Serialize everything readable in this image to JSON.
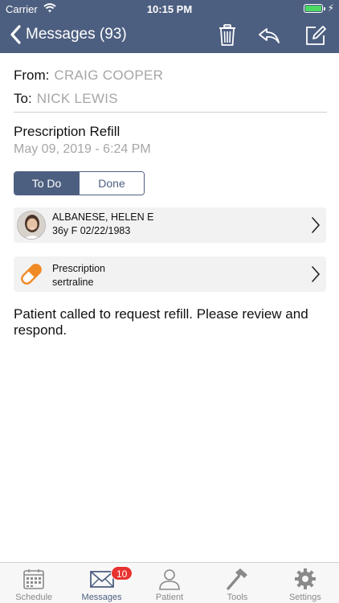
{
  "status_bar": {
    "carrier": "Carrier",
    "time": "10:15 PM",
    "battery_level": 1.0
  },
  "nav": {
    "back_label": "Messages (93)",
    "icons": [
      "chevron-left-icon",
      "trash-icon",
      "reply-icon",
      "compose-icon"
    ]
  },
  "message": {
    "from_label": "From:",
    "from_value": "CRAIG COOPER",
    "to_label": "To:",
    "to_value": "NICK LEWIS",
    "subject": "Prescription Refill",
    "date": "May 09, 2019 - 6:24 PM",
    "body": "Patient called to request refill. Please review and respond."
  },
  "segment": {
    "options": [
      "To Do",
      "Done"
    ],
    "selected": "To Do"
  },
  "patient_card": {
    "name": "ALBANESE, HELEN E",
    "details": "36y F 02/22/1983"
  },
  "rx_card": {
    "title": "Prescription",
    "drug": "sertraline"
  },
  "tabbar": {
    "tabs": [
      {
        "label": "Schedule",
        "icon": "calendar-icon"
      },
      {
        "label": "Messages",
        "icon": "envelope-icon"
      },
      {
        "label": "Patient",
        "icon": "person-icon"
      },
      {
        "label": "Tools",
        "icon": "hammer-icon"
      },
      {
        "label": "Settings",
        "icon": "gear-icon"
      }
    ],
    "active": "Messages",
    "messages_badge": "10"
  },
  "colors": {
    "header": "#4d5f80",
    "accent_orange": "#f08a24",
    "badge": "#e8322f",
    "muted_text": "#a6a6a6"
  }
}
